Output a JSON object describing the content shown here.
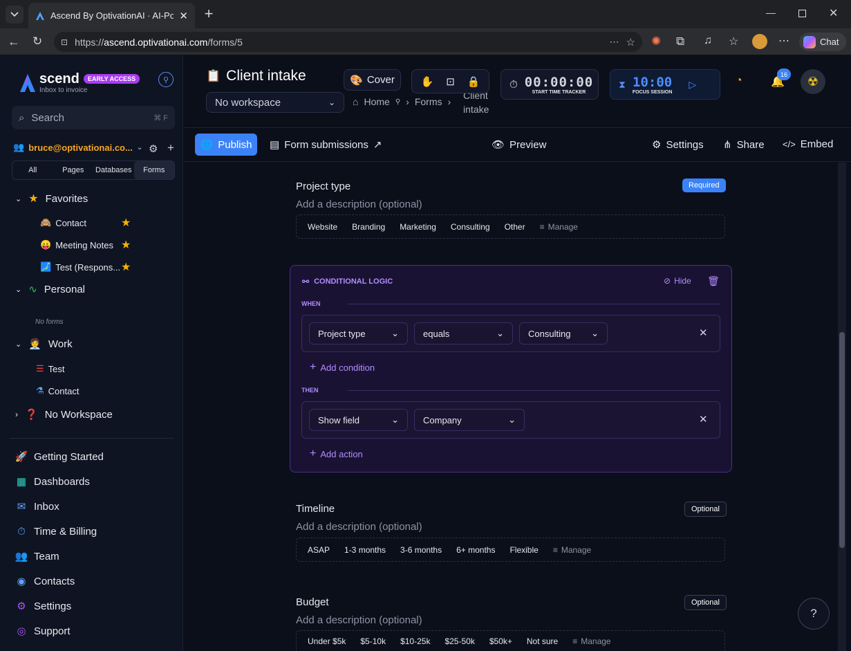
{
  "browser": {
    "tab_title": "Ascend By OptivationAI · AI-Powere",
    "url_scheme": "https://",
    "url_host": "ascend.optivationai.com",
    "url_path": "/forms/5",
    "chat_label": "Chat"
  },
  "sidebar": {
    "brand": "scend",
    "brand_badge": "EARLY ACCESS",
    "tagline": "Inbox to invoice",
    "search_placeholder": "Search",
    "search_shortcut": "⌘ F",
    "account": "bruce@optivationai.co...",
    "filters": [
      "All",
      "Pages",
      "Databases",
      "Forms"
    ],
    "favorites_label": "Favorites",
    "favorites": [
      {
        "emoji": "🙈",
        "label": "Contact"
      },
      {
        "emoji": "😛",
        "label": "Meeting Notes"
      },
      {
        "emoji": "🗾",
        "label": "Test (Respons..."
      }
    ],
    "personal_label": "Personal",
    "no_forms": "No forms",
    "work_label": "Work",
    "work_items": [
      "Test",
      "Contact"
    ],
    "no_workspace_label": "No Workspace",
    "bottom_nav": [
      "Getting Started",
      "Dashboards",
      "Inbox",
      "Time & Billing",
      "Team",
      "Contacts",
      "Settings",
      "Support"
    ]
  },
  "header": {
    "title": "Client intake",
    "workspace": "No workspace",
    "breadcrumb": [
      "Home",
      "Forms",
      "Client",
      "intake"
    ],
    "cover_label": "Cover",
    "timer": "00:00:00",
    "timer_label": "START TIME TRACKER",
    "focus_time": "10:00",
    "focus_label": "FOCUS SESSION",
    "notif_count": "16"
  },
  "toolbar": {
    "publish": "Publish",
    "submissions": "Form submissions",
    "preview": "Preview",
    "settings": "Settings",
    "share": "Share",
    "embed": "Embed"
  },
  "form": {
    "project_type": {
      "label": "Project type",
      "badge": "Required",
      "desc": "Add a description (optional)",
      "options": [
        "Website",
        "Branding",
        "Marketing",
        "Consulting",
        "Other"
      ],
      "manage": "Manage"
    },
    "logic": {
      "title": "CONDITIONAL LOGIC",
      "hide": "Hide",
      "when": "WHEN",
      "cond_field": "Project type",
      "cond_op": "equals",
      "cond_value": "Consulting",
      "add_condition": "Add condition",
      "then": "THEN",
      "action": "Show field",
      "action_target": "Company",
      "add_action": "Add action"
    },
    "timeline": {
      "label": "Timeline",
      "badge": "Optional",
      "desc": "Add a description (optional)",
      "options": [
        "ASAP",
        "1-3 months",
        "3-6 months",
        "6+ months",
        "Flexible"
      ],
      "manage": "Manage"
    },
    "budget": {
      "label": "Budget",
      "badge": "Optional",
      "desc": "Add a description (optional)",
      "options": [
        "Under $5k",
        "$5-10k",
        "$10-25k",
        "$25-50k",
        "$50k+",
        "Not sure"
      ],
      "manage": "Manage"
    }
  },
  "colors": {
    "accent": "#3b82f6",
    "logic": "#b18cff",
    "star": "#f5b400"
  }
}
